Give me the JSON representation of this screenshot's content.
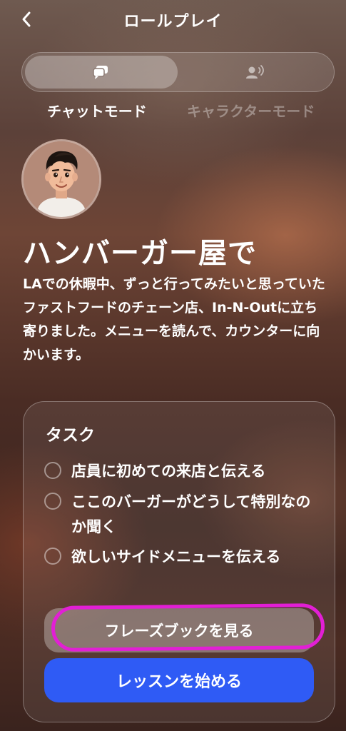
{
  "header": {
    "title": "ロールプレイ",
    "back_icon": "chevron-left-icon"
  },
  "mode_toggle": {
    "active_mode": "chat",
    "chat_icon": "chat-bubbles-icon",
    "character_icon": "speaking-person-icon",
    "chat_label": "チャットモード",
    "character_label": "キャラクターモード"
  },
  "scenario": {
    "title": "ハンバーガー屋で",
    "description": "LAでの休暇中、ずっと行ってみたいと思っていたファストフードのチェーン店、In-N-Outに立ち寄りました。メニューを読んで、カウンターに向かいます。"
  },
  "tasks": {
    "heading": "タスク",
    "items": [
      {
        "text": "店員に初めての来店と伝える",
        "done": false
      },
      {
        "text": "ここのバーガーがどうして特別なのか聞く",
        "done": false
      },
      {
        "text": "欲しいサイドメニューを伝える",
        "done": false
      }
    ]
  },
  "buttons": {
    "phrasebook": "フレーズブックを見る",
    "start_lesson": "レッスンを始める"
  },
  "colors": {
    "primary_button": "#2f5bf5",
    "highlight_annotation": "#e21fd5"
  }
}
